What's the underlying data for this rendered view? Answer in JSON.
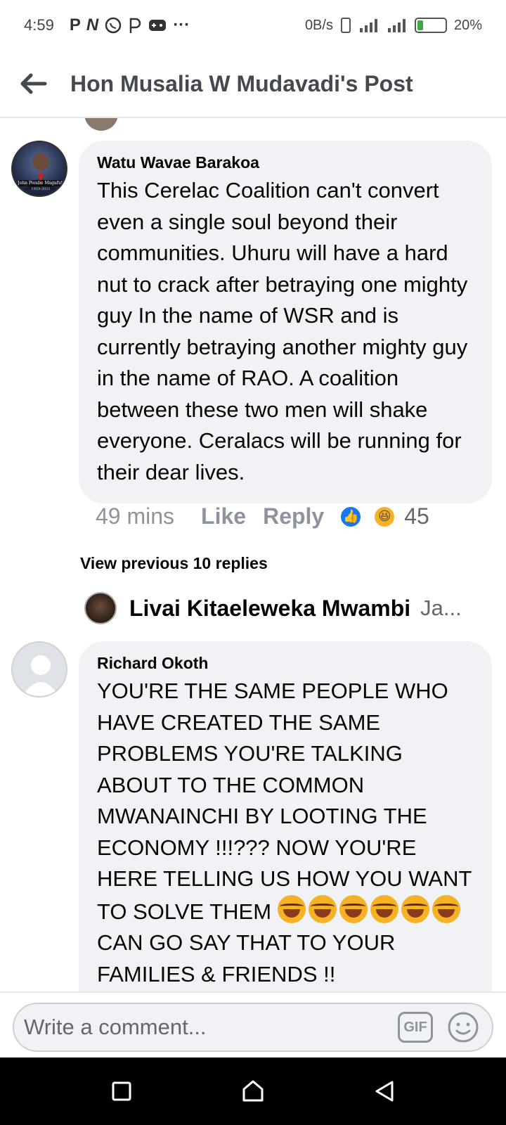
{
  "status": {
    "time": "4:59",
    "app_icons": [
      "P",
      "N",
      "whatsapp-icon",
      "P",
      "game-icon",
      "..."
    ],
    "net_speed": "0B/s",
    "battery": "20%",
    "battery_level": 0.2
  },
  "header": {
    "title": "Hon Musalia W Mudavadi's Post"
  },
  "comments": [
    {
      "author": "Watu Wavae Barakoa",
      "avatar_caption": "John Pombe Magufuli",
      "avatar_years": "1959-2021",
      "body": "This Cerelac Coalition can't convert even a single soul beyond their communities. Uhuru will have a hard nut to crack after betraying one mighty guy In the name of WSR and is currently betraying another mighty guy in the name of RAO. A coalition between these two men will shake everyone. Ceralacs will be running for their dear lives.",
      "time": "49 mins",
      "like_label": "Like",
      "reply_label": "Reply",
      "reaction_count": "45"
    },
    {
      "author": "Richard Okoth",
      "body": "YOU'RE THE SAME PEOPLE WHO HAVE CREATED THE SAME PROBLEMS YOU'RE TALKING ABOUT TO THE COMMON MWANAINCHI BY LOOTING THE ECONOMY !!!??? NOW YOU'RE HERE TELLING US HOW YOU WANT TO SOLVE THEM",
      "body_after": "CAN GO SAY THAT TO YOUR FAMILIES & FRIENDS !!",
      "emoji_count": 6
    }
  ],
  "view_previous": "View previous 10 replies",
  "reply_preview": {
    "name": "Livai Kitaeleweka Mwambi",
    "snippet": "Ja..."
  },
  "composer": {
    "placeholder": "Write a comment...",
    "gif_label": "GIF"
  },
  "colors": {
    "facebook_blue": "#1877f2",
    "bubble": "#f0f2f5",
    "muted_text": "#8d949e"
  }
}
